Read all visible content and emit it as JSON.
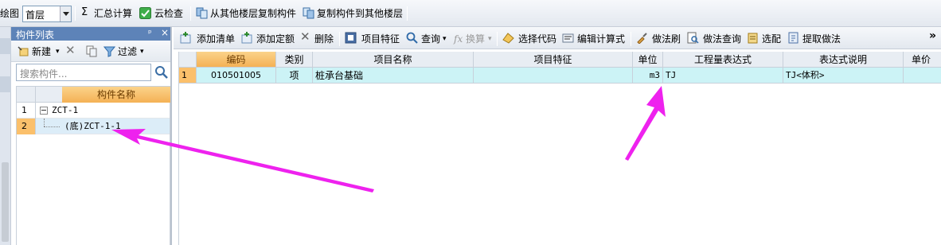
{
  "top_toolbar": {
    "draw_label": "绘图",
    "floor_value": "首层",
    "summary_calc": "汇总计算",
    "cloud_check": "云检查",
    "copy_from_floor": "从其他楼层复制构件",
    "copy_to_floor": "复制构件到其他楼层"
  },
  "left_panel": {
    "title": "构件列表",
    "pin": "ᵖ",
    "close": "×",
    "new_label": "新建",
    "filter_label": "过滤",
    "search_placeholder": "搜索构件...",
    "column_name": "构件名称",
    "rows": [
      {
        "num": "1",
        "label": "ZCT-1"
      },
      {
        "num": "2",
        "label": "(底)ZCT-1-1"
      }
    ]
  },
  "right_panel": {
    "toolbar": {
      "add_list": "添加清单",
      "add_quota": "添加定额",
      "delete": "删除",
      "item_feature": "项目特征",
      "query": "查询",
      "convert": "换算",
      "select_code": "选择代码",
      "edit_formula": "编辑计算式",
      "method_brush": "做法刷",
      "method_query": "做法查询",
      "select_match": "选配",
      "extract_method": "提取做法",
      "more": "»"
    },
    "grid": {
      "columns": [
        "编码",
        "类别",
        "项目名称",
        "项目特征",
        "单位",
        "工程量表达式",
        "表达式说明",
        "单价"
      ],
      "rows": [
        {
          "num": "1",
          "code": "010501005",
          "category": "项",
          "name": "桩承台基础",
          "feature": "",
          "unit": "m3",
          "expression": "TJ",
          "expression_desc": "TJ<体积>",
          "price": ""
        }
      ]
    }
  },
  "colors": {
    "title_blue": "#5d83b8",
    "header_orange": "#f4b155",
    "row_highlight": "#ccf3f6",
    "annotation_magenta": "#ee22ee"
  }
}
